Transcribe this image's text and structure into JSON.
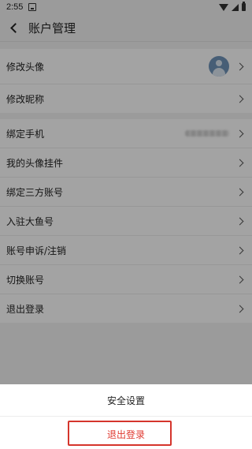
{
  "status_bar": {
    "time": "2:55"
  },
  "header": {
    "title": "账户管理"
  },
  "groups": [
    {
      "items": [
        {
          "label": "修改头像"
        },
        {
          "label": "修改昵称"
        }
      ]
    },
    {
      "items": [
        {
          "label": "绑定手机"
        },
        {
          "label": "我的头像挂件"
        },
        {
          "label": "绑定三方账号"
        },
        {
          "label": "入驻大鱼号"
        },
        {
          "label": "账号申诉/注销"
        },
        {
          "label": "切换账号"
        },
        {
          "label": "退出登录"
        }
      ]
    }
  ],
  "action_sheet": {
    "security_label": "安全设置",
    "logout_label": "退出登录"
  },
  "colors": {
    "danger": "#e03a31",
    "highlight_border": "#d5352c",
    "avatar": "#6f93b9"
  }
}
